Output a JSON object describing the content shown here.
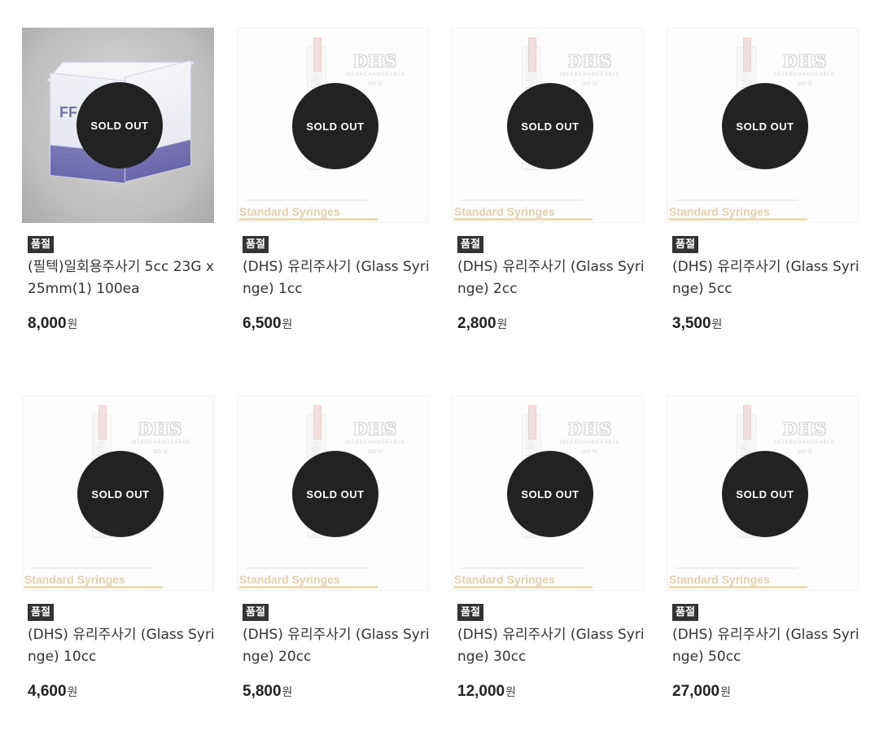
{
  "products": [
    {
      "badge": "품절",
      "name": "(필텍)일회용주사기 5cc 23G x 25mm(1) 100ea",
      "price": "8,000",
      "unit": "원",
      "sold_out": "SOLD OUT",
      "box_brand": "FF"
    },
    {
      "badge": "품절",
      "name": "(DHS) 유리주사기 (Glass Syringe) 1cc",
      "price": "6,500",
      "unit": "원",
      "sold_out": "SOLD OUT",
      "image_caption": "Standard Syringes",
      "logo": "DHS",
      "logo_sub": "INTERCHANGEABLE",
      "logo_temp": "200 °C"
    },
    {
      "badge": "품절",
      "name": "(DHS) 유리주사기 (Glass Syringe) 2cc",
      "price": "2,800",
      "unit": "원",
      "sold_out": "SOLD OUT",
      "image_caption": "Standard Syringes",
      "logo": "DHS",
      "logo_sub": "INTERCHANGEABLE",
      "logo_temp": "200 °C"
    },
    {
      "badge": "품절",
      "name": "(DHS) 유리주사기 (Glass Syringe) 5cc",
      "price": "3,500",
      "unit": "원",
      "sold_out": "SOLD OUT",
      "image_caption": "Standard Syringes",
      "logo": "DHS",
      "logo_sub": "INTERCHANGEABLE",
      "logo_temp": "200 °C"
    },
    {
      "badge": "품절",
      "name": "(DHS) 유리주사기 (Glass Syringe) 10cc",
      "price": "4,600",
      "unit": "원",
      "sold_out": "SOLD OUT",
      "image_caption": "Standard Syringes",
      "logo": "DHS",
      "logo_sub": "INTERCHANGEABLE",
      "logo_temp": "200 °C"
    },
    {
      "badge": "품절",
      "name": "(DHS) 유리주사기 (Glass Syringe) 20cc",
      "price": "5,800",
      "unit": "원",
      "sold_out": "SOLD OUT",
      "image_caption": "Standard Syringes",
      "logo": "DHS",
      "logo_sub": "INTERCHANGEABLE",
      "logo_temp": "200 °C"
    },
    {
      "badge": "품절",
      "name": "(DHS) 유리주사기 (Glass Syringe) 30cc",
      "price": "12,000",
      "unit": "원",
      "sold_out": "SOLD OUT",
      "image_caption": "Standard Syringes",
      "logo": "DHS",
      "logo_sub": "INTERCHANGEABLE",
      "logo_temp": "200 °C"
    },
    {
      "badge": "품절",
      "name": "(DHS) 유리주사기 (Glass Syringe) 50cc",
      "price": "27,000",
      "unit": "원",
      "sold_out": "SOLD OUT",
      "image_caption": "Standard Syringes",
      "logo": "DHS",
      "logo_sub": "INTERCHANGEABLE",
      "logo_temp": "200 °C"
    }
  ],
  "colors": {
    "sold_out_circle": "#222222",
    "badge_bg": "#333333",
    "caption": "#e1d1ac"
  }
}
